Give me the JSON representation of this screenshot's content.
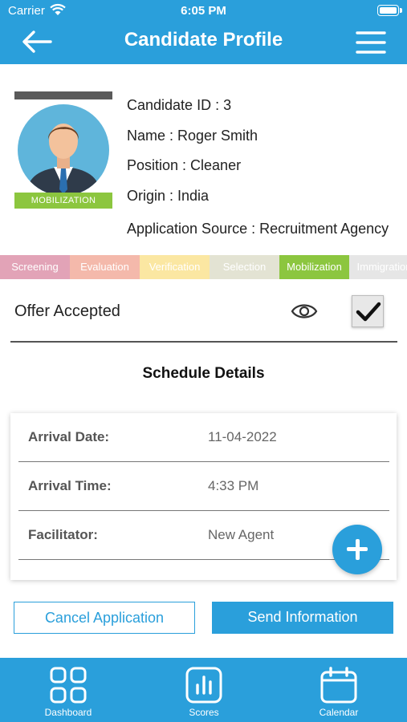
{
  "status_bar": {
    "carrier": "Carrier",
    "time": "6:05 PM"
  },
  "header": {
    "title": "Candidate Profile"
  },
  "candidate": {
    "stage_badge": "MOBILIZATION",
    "id_line": "Candidate ID : 3",
    "name_line": "Name : Roger Smith",
    "position_line": "Position : Cleaner",
    "origin_line": "Origin : India",
    "source_line": "Application Source : Recruitment Agency"
  },
  "stages": [
    {
      "label": "Screening",
      "color": "#e2a3b7"
    },
    {
      "label": "Evaluation",
      "color": "#f4b9ab"
    },
    {
      "label": "Verification",
      "color": "#fbe7a2"
    },
    {
      "label": "Selection",
      "color": "#e3e3d3"
    },
    {
      "label": "Mobilization",
      "color": "#8cc63f"
    },
    {
      "label": "Immigration",
      "color": "#e6e6e6"
    }
  ],
  "offer": {
    "label": "Offer Accepted",
    "checked": true
  },
  "schedule": {
    "title": "Schedule Details",
    "rows": [
      {
        "label": "Arrival Date:",
        "value": "11-04-2022"
      },
      {
        "label": "Arrival Time:",
        "value": "4:33 PM"
      },
      {
        "label": "Facilitator:",
        "value": "New Agent"
      }
    ]
  },
  "actions": {
    "cancel_label": "Cancel Application",
    "send_label": "Send Information"
  },
  "bottom_nav": [
    {
      "label": "Dashboard",
      "icon": "dashboard-grid-icon"
    },
    {
      "label": "Scores",
      "icon": "bar-chart-icon"
    },
    {
      "label": "Calendar",
      "icon": "calendar-icon"
    }
  ],
  "colors": {
    "primary": "#2a9fdb",
    "mobilization": "#8cc63f"
  }
}
